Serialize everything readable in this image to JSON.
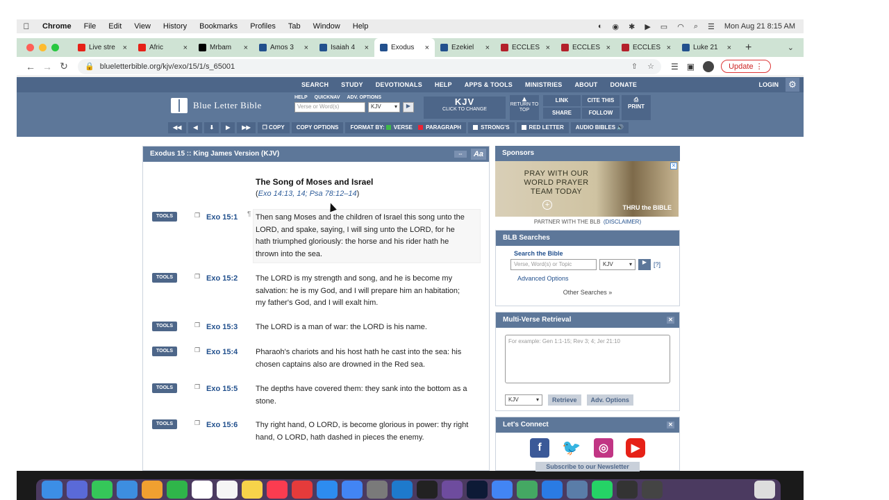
{
  "menubar": {
    "app": "Chrome",
    "items": [
      "File",
      "Edit",
      "View",
      "History",
      "Bookmarks",
      "Profiles",
      "Tab",
      "Window",
      "Help"
    ],
    "datetime": "Mon Aug 21  8:15 AM"
  },
  "tabs": [
    {
      "label": "Live stre",
      "icon": "youtube-icon",
      "color": "#e62117",
      "active": false
    },
    {
      "label": "Afric",
      "icon": "youtube-icon",
      "color": "#e62117",
      "active": false
    },
    {
      "label": "Mrbam",
      "icon": "x-icon",
      "color": "#000000",
      "active": false
    },
    {
      "label": "Amos 3",
      "icon": "blb-icon",
      "color": "#22508d",
      "active": false
    },
    {
      "label": "Isaiah 4",
      "icon": "blb-icon",
      "color": "#22508d",
      "active": false
    },
    {
      "label": "Exodus",
      "icon": "blb-icon",
      "color": "#22508d",
      "active": true
    },
    {
      "label": "Ezekiel",
      "icon": "blb-icon",
      "color": "#22508d",
      "active": false
    },
    {
      "label": "ECCLES",
      "icon": "bookmark-icon",
      "color": "#b3202a",
      "active": false
    },
    {
      "label": "ECCLES",
      "icon": "bookmark-icon",
      "color": "#b3202a",
      "active": false
    },
    {
      "label": "ECCLES",
      "icon": "bookmark-icon",
      "color": "#b3202a",
      "active": false
    },
    {
      "label": "Luke 21",
      "icon": "blb-icon",
      "color": "#22508d",
      "active": false
    }
  ],
  "address": {
    "url": "blueletterbible.org/kjv/exo/15/1/s_65001",
    "update_label": "Update"
  },
  "blb": {
    "nav": [
      "SEARCH",
      "STUDY",
      "DEVOTIONALS",
      "HELP",
      "APPS & TOOLS",
      "MINISTRIES",
      "ABOUT",
      "DONATE"
    ],
    "login": "LOGIN",
    "logo_text": "Blue Letter Bible",
    "search_links": [
      "HELP",
      "QUICKNAV",
      "ADV. OPTIONS"
    ],
    "search_placeholder": "Verse or Word(s)",
    "version": "KJV",
    "kjv_label": "KJV",
    "kjv_sub": "CLICK TO CHANGE",
    "return_top": "RETURN TO TOP",
    "link": "LINK",
    "cite": "CITE THIS",
    "share": "SHARE",
    "follow": "FOLLOW",
    "print": "PRINT",
    "toolbar": {
      "copy": "COPY",
      "copy_options": "COPY OPTIONS",
      "format_by": "FORMAT BY:",
      "verse": "VERSE",
      "paragraph": "PARAGRAPH",
      "strongs": "STRONG'S",
      "red_letter": "RED LETTER",
      "audio": "AUDIO BIBLES"
    }
  },
  "passage": {
    "title": "Exodus 15 :: King James Version (KJV)",
    "aa": "Aa",
    "heading": "The Song of Moses and Israel",
    "xref_open": "(",
    "xref": "Exo 14:13, 14; Psa 78:12–14",
    "xref_close": ")",
    "tools_label": "TOOLS",
    "verses": [
      {
        "ref": "Exo 15:1",
        "text": "Then sang Moses and the children of Israel this song unto the LORD, and spake, saying, I will sing unto the LORD, for he hath triumphed gloriously: the horse and his rider hath he thrown into the sea."
      },
      {
        "ref": "Exo 15:2",
        "text": "The LORD is my strength and song, and he is become my salvation: he is my God, and I will prepare him an habitation; my father's God, and I will exalt him."
      },
      {
        "ref": "Exo 15:3",
        "text": "The LORD is a man of war: the LORD is his name."
      },
      {
        "ref": "Exo 15:4",
        "text": "Pharaoh's chariots and his host hath he cast into the sea: his chosen captains also are drowned in the Red sea."
      },
      {
        "ref": "Exo 15:5",
        "text": "The depths have covered them: they sank into the bottom as a stone."
      },
      {
        "ref": "Exo 15:6",
        "text": "Thy right hand, O LORD, is become glorious in power: thy right hand, O LORD, hath dashed in pieces the enemy."
      }
    ]
  },
  "sidebar": {
    "sponsors_title": "Sponsors",
    "ad_text": "PRAY WITH OUR WORLD PRAYER TEAM TODAY",
    "ad_brand": "THRU the BIBLE",
    "partner": "PARTNER WITH THE BLB",
    "disclaimer": "(DISCLAIMER)",
    "searches_title": "BLB Searches",
    "search_label": "Search the Bible",
    "search_placeholder": "Verse, Word(s) or Topic",
    "search_version": "KJV",
    "help_q": "[?]",
    "advanced": "Advanced Options",
    "other": "Other Searches »",
    "mvr_title": "Multi-Verse Retrieval",
    "mvr_placeholder": "For example: Gen 1:1-15; Rev 3; 4; Jer 21:10",
    "mvr_version": "KJV",
    "retrieve": "Retrieve",
    "adv_options": "Adv. Options",
    "connect_title": "Let's Connect",
    "newsletter": "Subscribe to our Newsletter"
  }
}
